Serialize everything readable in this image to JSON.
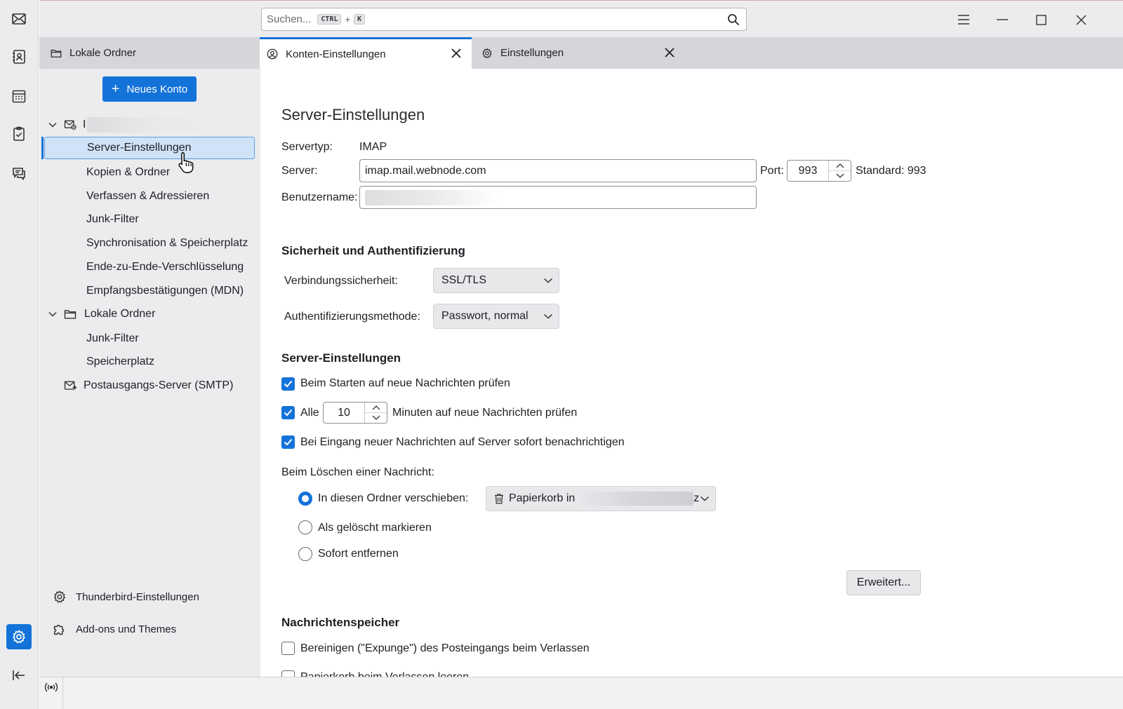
{
  "search": {
    "placeholder": "Suchen...",
    "key1": "CTRL",
    "plus": "+",
    "key2": "K"
  },
  "tabs": [
    {
      "label": "Lokale Ordner",
      "icon": "folder-icon"
    },
    {
      "label": "Konten-Einstellungen",
      "icon": "account-icon"
    },
    {
      "label": "Einstellungen",
      "icon": "gear-icon"
    }
  ],
  "sidebar": {
    "new_account": "Neues Konto",
    "account_initial": "I",
    "account_items": [
      "Server-Einstellungen",
      "Kopien & Ordner",
      "Verfassen & Adressieren",
      "Junk-Filter",
      "Synchronisation & Speicherplatz",
      "Ende-zu-Ende-Verschlüsselung",
      "Empfangsbestätigungen (MDN)"
    ],
    "local_folders": "Lokale Ordner",
    "local_items": [
      "Junk-Filter",
      "Speicherplatz"
    ],
    "smtp": "Postausgangs-Server (SMTP)",
    "thunderbird_settings": "Thunderbird-Einstellungen",
    "addons": "Add-ons und Themes"
  },
  "main": {
    "title": "Server-Einstellungen",
    "server_type_label": "Servertyp:",
    "server_type_value": "IMAP",
    "server_label": "Server:",
    "server_value": "imap.mail.webnode.com",
    "port_label": "Port:",
    "port_value": "993",
    "standard_label": "Standard: 993",
    "username_label": "Benutzername:",
    "security_heading": "Sicherheit und Authentifizierung",
    "conn_security_label": "Verbindungssicherheit:",
    "conn_security_value": "SSL/TLS",
    "auth_method_label": "Authentifizierungsmethode:",
    "auth_method_value": "Passwort, normal",
    "server_settings_heading": "Server-Einstellungen",
    "check_on_start": "Beim Starten auf neue Nachrichten prüfen",
    "check_every_label": "Alle",
    "check_every_value": "10",
    "check_every_suffix": "Minuten auf neue Nachrichten prüfen",
    "notify_immediately": "Bei Eingang neuer Nachrichten auf Server sofort benachrichtigen",
    "on_delete_label": "Beim Löschen einer Nachricht:",
    "move_to_folder": "In diesen Ordner verschieben:",
    "trash_folder_value": "Papierkorb in",
    "trash_folder_tail": "z",
    "mark_deleted": "Als gelöscht markieren",
    "remove_immediately": "Sofort entfernen",
    "advanced_button": "Erweitert...",
    "storage_heading": "Nachrichtenspeicher",
    "expunge_inbox": "Bereinigen (\"Expunge\") des Posteingangs beim Verlassen",
    "empty_trash": "Papierkorb beim Verlassen leeren"
  },
  "states": {
    "check_on_start": true,
    "check_every": true,
    "notify_immediately": true,
    "delete_action": "move",
    "expunge_inbox": false,
    "empty_trash": false
  },
  "colors": {
    "accent": "#1373d9"
  }
}
